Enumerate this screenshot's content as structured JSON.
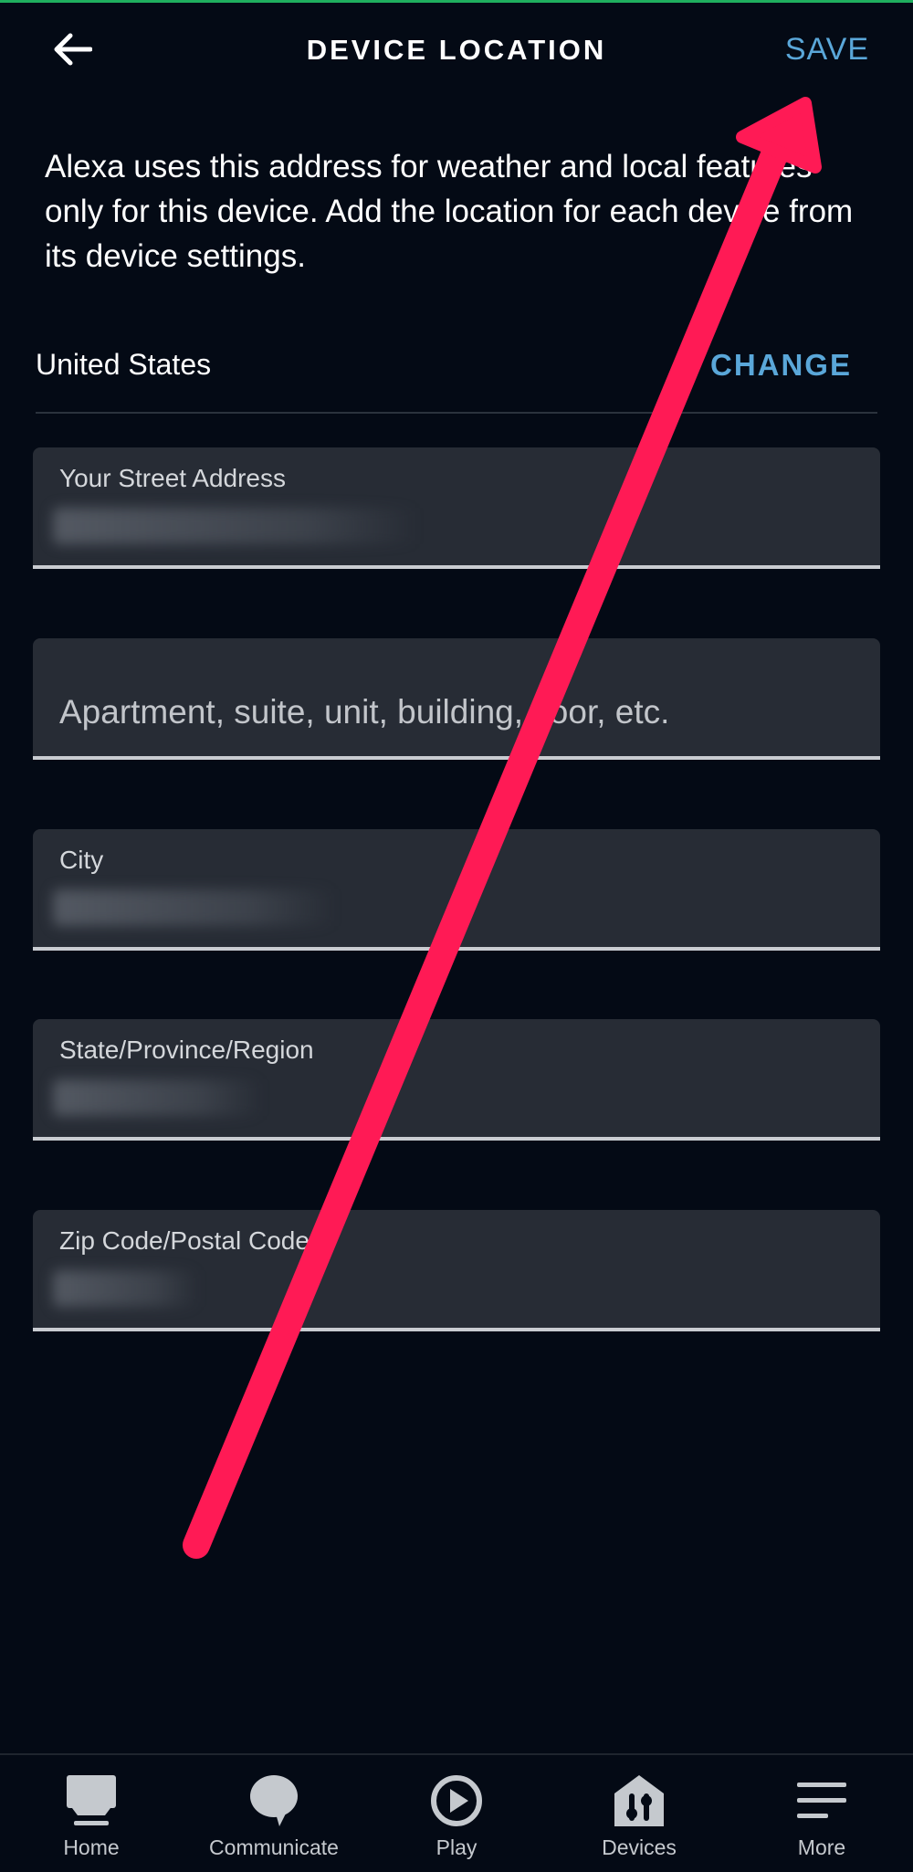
{
  "header": {
    "back_icon": "arrow-left-icon",
    "title": "DEVICE LOCATION",
    "save_label": "SAVE"
  },
  "description": "Alexa uses this address for weather and local features only for this device. Add the location for each device from its device settings.",
  "country": {
    "name": "United States",
    "change_label": "CHANGE"
  },
  "form": {
    "street": {
      "label": "Your Street Address",
      "value": ""
    },
    "apartment": {
      "placeholder": "Apartment, suite, unit, building, floor, etc."
    },
    "city": {
      "label": "City",
      "value": ""
    },
    "state": {
      "label": "State/Province/Region",
      "value": ""
    },
    "zip": {
      "label": "Zip Code/Postal Code",
      "value": ""
    }
  },
  "annotation": {
    "color": "#ff1a55",
    "icon": "annotation-arrow"
  },
  "bottom_nav": [
    {
      "label": "Home",
      "icon": "home-icon"
    },
    {
      "label": "Communicate",
      "icon": "chat-bubble-icon"
    },
    {
      "label": "Play",
      "icon": "play-icon"
    },
    {
      "label": "Devices",
      "icon": "devices-icon"
    },
    {
      "label": "More",
      "icon": "menu-icon"
    }
  ],
  "colors": {
    "background": "#040a15",
    "accent": "#5aa7d9",
    "field_bg": "#272c35"
  }
}
